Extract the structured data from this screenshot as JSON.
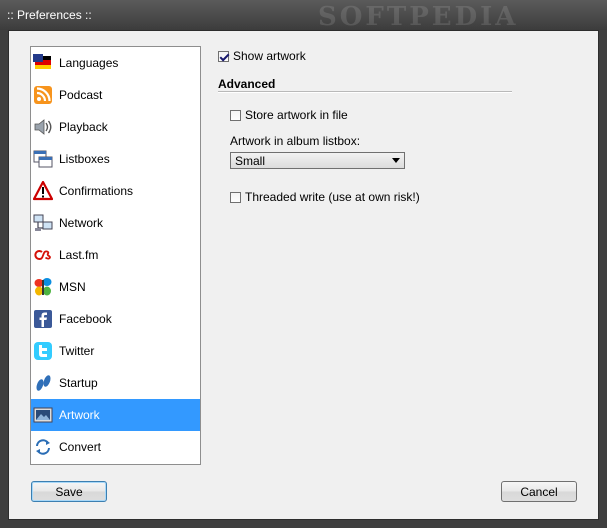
{
  "window": {
    "title": ":: Preferences ::",
    "watermark": "SOFTPEDIA"
  },
  "nav": {
    "items": [
      {
        "label": "Languages",
        "icon": "flag-icon"
      },
      {
        "label": "Podcast",
        "icon": "rss-icon"
      },
      {
        "label": "Playback",
        "icon": "speaker-icon"
      },
      {
        "label": "Listboxes",
        "icon": "listbox-icon"
      },
      {
        "label": "Confirmations",
        "icon": "warning-icon"
      },
      {
        "label": "Network",
        "icon": "network-icon"
      },
      {
        "label": "Last.fm",
        "icon": "lastfm-icon"
      },
      {
        "label": "MSN",
        "icon": "msn-butterfly-icon"
      },
      {
        "label": "Facebook",
        "icon": "facebook-icon"
      },
      {
        "label": "Twitter",
        "icon": "twitter-icon"
      },
      {
        "label": "Startup",
        "icon": "footprints-icon"
      },
      {
        "label": "Artwork",
        "icon": "artwork-icon",
        "selected": true
      },
      {
        "label": "Convert",
        "icon": "convert-icon"
      }
    ]
  },
  "artwork": {
    "show_artwork_label": "Show artwork",
    "show_artwork_checked": true,
    "advanced_title": "Advanced",
    "store_in_file_label": "Store artwork in file",
    "store_in_file_checked": false,
    "album_listbox_label": "Artwork in album listbox:",
    "album_listbox_value": "Small",
    "threaded_write_label": "Threaded write (use at own risk!)",
    "threaded_write_checked": false
  },
  "buttons": {
    "save": "Save",
    "cancel": "Cancel"
  }
}
